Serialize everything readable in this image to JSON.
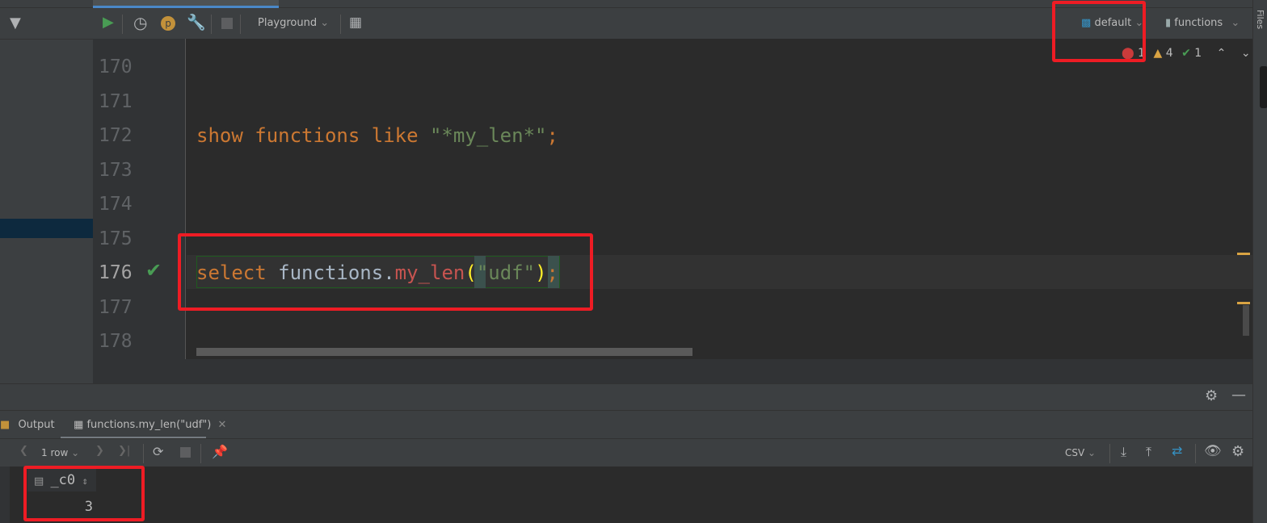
{
  "toolbar": {
    "console_label": "Playground",
    "schema_label": "default",
    "session_label": "functions"
  },
  "inspections": {
    "errors": "1",
    "warnings": "4",
    "ok": "1"
  },
  "editor": {
    "lines": [
      {
        "number": "170",
        "tokens": []
      },
      {
        "number": "171",
        "tokens": []
      },
      {
        "number": "172",
        "tokens": [
          {
            "text": "show functions like ",
            "type": "kw"
          },
          {
            "text": "\"*my_len*\"",
            "type": "str"
          },
          {
            "text": ";",
            "type": "kw"
          }
        ]
      },
      {
        "number": "173",
        "tokens": []
      },
      {
        "number": "174",
        "tokens": []
      },
      {
        "number": "175",
        "tokens": []
      },
      {
        "number": "176",
        "tokens": [
          {
            "text": "select ",
            "type": "kw"
          },
          {
            "text": "functions",
            "type": "id"
          },
          {
            "text": ".",
            "type": "id"
          },
          {
            "text": "my_len",
            "type": "fn"
          },
          {
            "text": "(",
            "type": "br"
          },
          {
            "text": "\"udf\"",
            "type": "str"
          },
          {
            "text": ")",
            "type": "br"
          },
          {
            "text": ";",
            "type": "kw"
          }
        ]
      },
      {
        "number": "177",
        "tokens": []
      },
      {
        "number": "178",
        "tokens": []
      }
    ],
    "executed_line_status": "success"
  },
  "right_strip": {
    "files_label": "Files"
  },
  "results": {
    "tabs": [
      {
        "label": "Output"
      },
      {
        "label": "functions.my_len(\"udf\")",
        "active": true
      }
    ],
    "row_count": "1 row",
    "export_format": "CSV",
    "columns": [
      "_c0"
    ],
    "rows": [
      [
        "3"
      ]
    ]
  },
  "colors": {
    "keyword": "#cc7832",
    "string": "#6a8759",
    "function": "#c75450",
    "highlight_box": "#ee1c24"
  }
}
